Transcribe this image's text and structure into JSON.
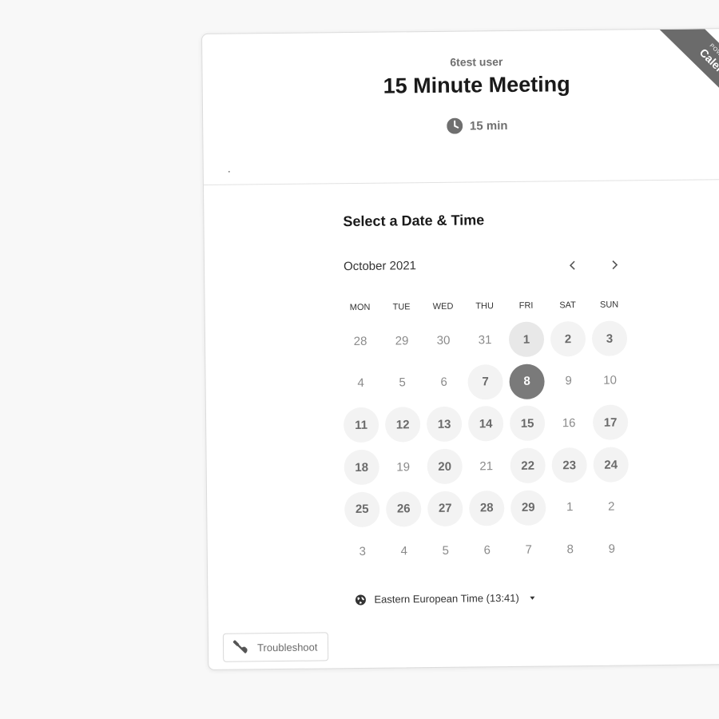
{
  "header": {
    "host_name": "6test user",
    "event_title": "15 Minute Meeting",
    "duration": "15 min",
    "description": "."
  },
  "ribbon": {
    "small": "POWERED BY",
    "big": "Calendly"
  },
  "picker": {
    "title": "Select a Date & Time",
    "month_label": "October 2021",
    "weekdays": [
      "MON",
      "TUE",
      "WED",
      "THU",
      "FRI",
      "SAT",
      "SUN"
    ],
    "days": [
      {
        "label": "28",
        "state": "other"
      },
      {
        "label": "29",
        "state": "other"
      },
      {
        "label": "30",
        "state": "other"
      },
      {
        "label": "31",
        "state": "other"
      },
      {
        "label": "1",
        "state": "today"
      },
      {
        "label": "2",
        "state": "avail"
      },
      {
        "label": "3",
        "state": "avail"
      },
      {
        "label": "4",
        "state": "disabled"
      },
      {
        "label": "5",
        "state": "disabled"
      },
      {
        "label": "6",
        "state": "disabled"
      },
      {
        "label": "7",
        "state": "avail"
      },
      {
        "label": "8",
        "state": "selected"
      },
      {
        "label": "9",
        "state": "disabled"
      },
      {
        "label": "10",
        "state": "disabled"
      },
      {
        "label": "11",
        "state": "avail"
      },
      {
        "label": "12",
        "state": "avail"
      },
      {
        "label": "13",
        "state": "avail"
      },
      {
        "label": "14",
        "state": "avail"
      },
      {
        "label": "15",
        "state": "avail"
      },
      {
        "label": "16",
        "state": "disabled"
      },
      {
        "label": "17",
        "state": "avail"
      },
      {
        "label": "18",
        "state": "avail"
      },
      {
        "label": "19",
        "state": "disabled"
      },
      {
        "label": "20",
        "state": "avail"
      },
      {
        "label": "21",
        "state": "disabled"
      },
      {
        "label": "22",
        "state": "avail"
      },
      {
        "label": "23",
        "state": "avail"
      },
      {
        "label": "24",
        "state": "avail"
      },
      {
        "label": "25",
        "state": "avail"
      },
      {
        "label": "26",
        "state": "avail"
      },
      {
        "label": "27",
        "state": "avail"
      },
      {
        "label": "28",
        "state": "avail"
      },
      {
        "label": "29",
        "state": "avail"
      },
      {
        "label": "1",
        "state": "other"
      },
      {
        "label": "2",
        "state": "other"
      },
      {
        "label": "3",
        "state": "other"
      },
      {
        "label": "4",
        "state": "other"
      },
      {
        "label": "5",
        "state": "other"
      },
      {
        "label": "6",
        "state": "other"
      },
      {
        "label": "7",
        "state": "other"
      },
      {
        "label": "8",
        "state": "other"
      },
      {
        "label": "9",
        "state": "other"
      }
    ]
  },
  "timezone": {
    "label": "Eastern European Time (13:41)",
    "icon": "globe-icon"
  },
  "troubleshoot": {
    "label": "Troubleshoot",
    "icon": "wrench-icon"
  },
  "icons": {
    "duration": "clock-icon",
    "prev": "chevron-left-icon",
    "next": "chevron-right-icon"
  },
  "colors": {
    "selected_day": "#7a7a7a",
    "available_day": "#f3f3f3",
    "ribbon": "#6b6b6b"
  }
}
